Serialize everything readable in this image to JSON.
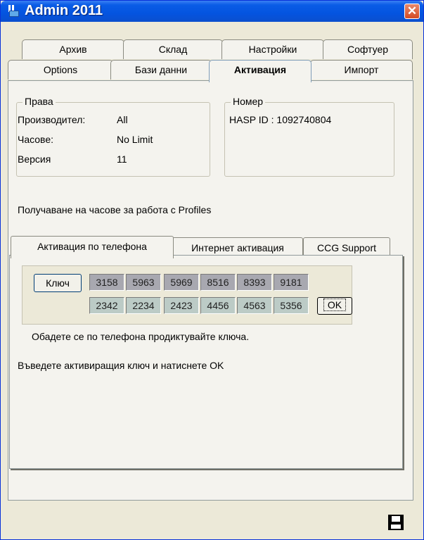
{
  "window": {
    "title": "Admin 2011"
  },
  "main_tabs": {
    "row1": [
      "Архив",
      "Склад",
      "Настройки",
      "Софтуер"
    ],
    "row2": [
      "Options",
      "Бази данни",
      "Активация",
      "Импорт"
    ],
    "active": "Активация"
  },
  "rights": {
    "legend": "Права",
    "rows": [
      {
        "label": "Производител:",
        "value": "All"
      },
      {
        "label": "Часове:",
        "value": "No Limit"
      },
      {
        "label": "Версия",
        "value": "11"
      }
    ]
  },
  "number": {
    "legend": "Номер",
    "hasp": "HASP ID : 1092740804"
  },
  "info_text": "Получаване на часове за работа с Profiles",
  "sub_tabs": {
    "items": [
      "Активация по телефона",
      "Интернет активация",
      "CCG Support"
    ],
    "active": "Активация по телефона"
  },
  "activation": {
    "key_button": "Ключ",
    "ok_button": "OK",
    "key_row1": [
      "3158",
      "5963",
      "5969",
      "8516",
      "8393",
      "9181"
    ],
    "key_row2": [
      "2342",
      "2234",
      "2423",
      "4456",
      "4563",
      "5356"
    ],
    "instruction1": "Обадете се по телефона продиктувайте ключа.",
    "instruction2": "Въведете активиращия ключ и натиснете OK"
  },
  "icons": {
    "window": "app-icon",
    "close": "close-icon",
    "save": "save-icon"
  },
  "colors": {
    "titlebar": "#0454e0",
    "close": "#d44b24",
    "panel": "#ece9d8"
  }
}
